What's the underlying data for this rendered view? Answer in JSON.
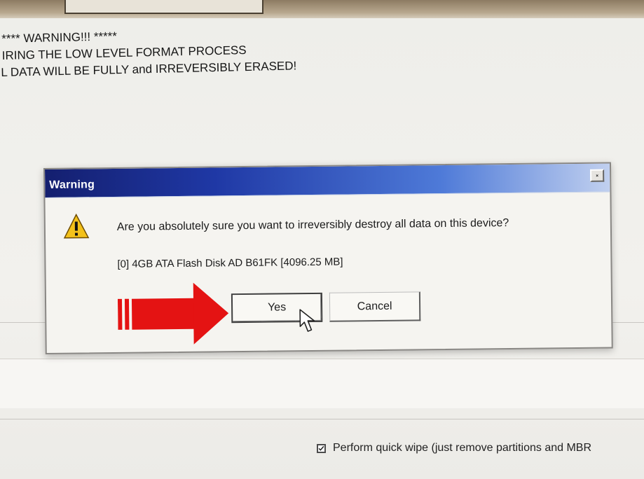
{
  "background": {
    "warning_lines": [
      "**** WARNING!!! *****",
      "IRING THE LOW LEVEL FORMAT PROCESS",
      "L DATA WILL BE FULLY and IRREVERSIBLY ERASED!"
    ],
    "quick_wipe_label": "Perform quick wipe (just remove partitions and MBR"
  },
  "dialog": {
    "title": "Warning",
    "message": "Are you absolutely sure you want to irreversibly destroy all data on this device?",
    "device_info": "[0]  4GB ATA Flash Disk    AD B61FK    [4096.25 MB]",
    "buttons": {
      "yes": "Yes",
      "cancel": "Cancel"
    }
  },
  "colors": {
    "title_bar_dark": "#141f6f",
    "title_bar_light": "#c1d0ef",
    "arrow": "#e41313",
    "warning_icon": "#f3c11a"
  },
  "icons": {
    "close": "close-icon",
    "warning": "warning-icon",
    "pointer": "cursor-icon",
    "arrow": "arrow-icon"
  }
}
